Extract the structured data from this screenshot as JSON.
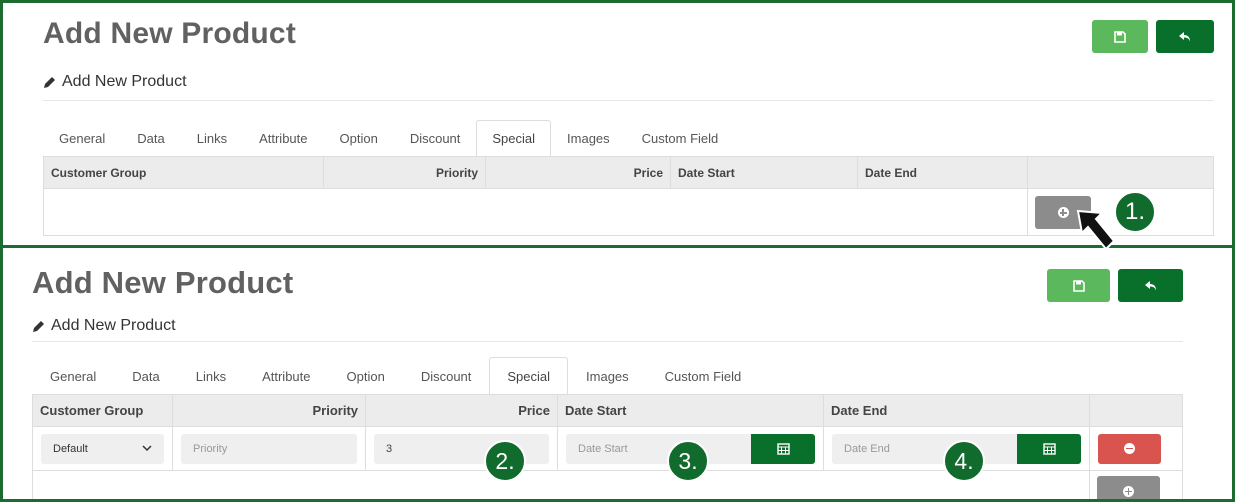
{
  "top": {
    "title": "Add New Product",
    "subtitle": "Add New Product",
    "tabs": [
      "General",
      "Data",
      "Links",
      "Attribute",
      "Option",
      "Discount",
      "Special",
      "Images",
      "Custom Field"
    ],
    "active_tab": "Special",
    "columns": [
      "Customer Group",
      "Priority",
      "Price",
      "Date Start",
      "Date End"
    ],
    "badge": "1."
  },
  "bottom": {
    "title": "Add New Product",
    "subtitle": "Add New Product",
    "tabs": [
      "General",
      "Data",
      "Links",
      "Attribute",
      "Option",
      "Discount",
      "Special",
      "Images",
      "Custom Field"
    ],
    "active_tab": "Special",
    "columns": [
      "Customer Group",
      "Priority",
      "Price",
      "Date Start",
      "Date End"
    ],
    "row": {
      "customer_group": "Default",
      "priority_placeholder": "Priority",
      "price_value": "3",
      "date_start_placeholder": "Date Start",
      "date_end_placeholder": "Date End"
    },
    "badges": [
      "2.",
      "3.",
      "4."
    ]
  },
  "icons": {
    "save": "floppy-disk-icon",
    "back": "reply-arrow-icon",
    "edit": "pencil-icon",
    "add": "plus-circle-icon",
    "remove": "minus-circle-icon",
    "calendar": "calendar-icon",
    "dropdown": "chevron-down-icon",
    "pointer": "arrow-pointer-icon"
  },
  "colors": {
    "border_green": "#1c6b30",
    "save_button": "#5cb85c",
    "back_button": "#08702b",
    "add_button": "#8c8c8c",
    "remove_button": "#d9534f",
    "badge": "#116b2c"
  }
}
